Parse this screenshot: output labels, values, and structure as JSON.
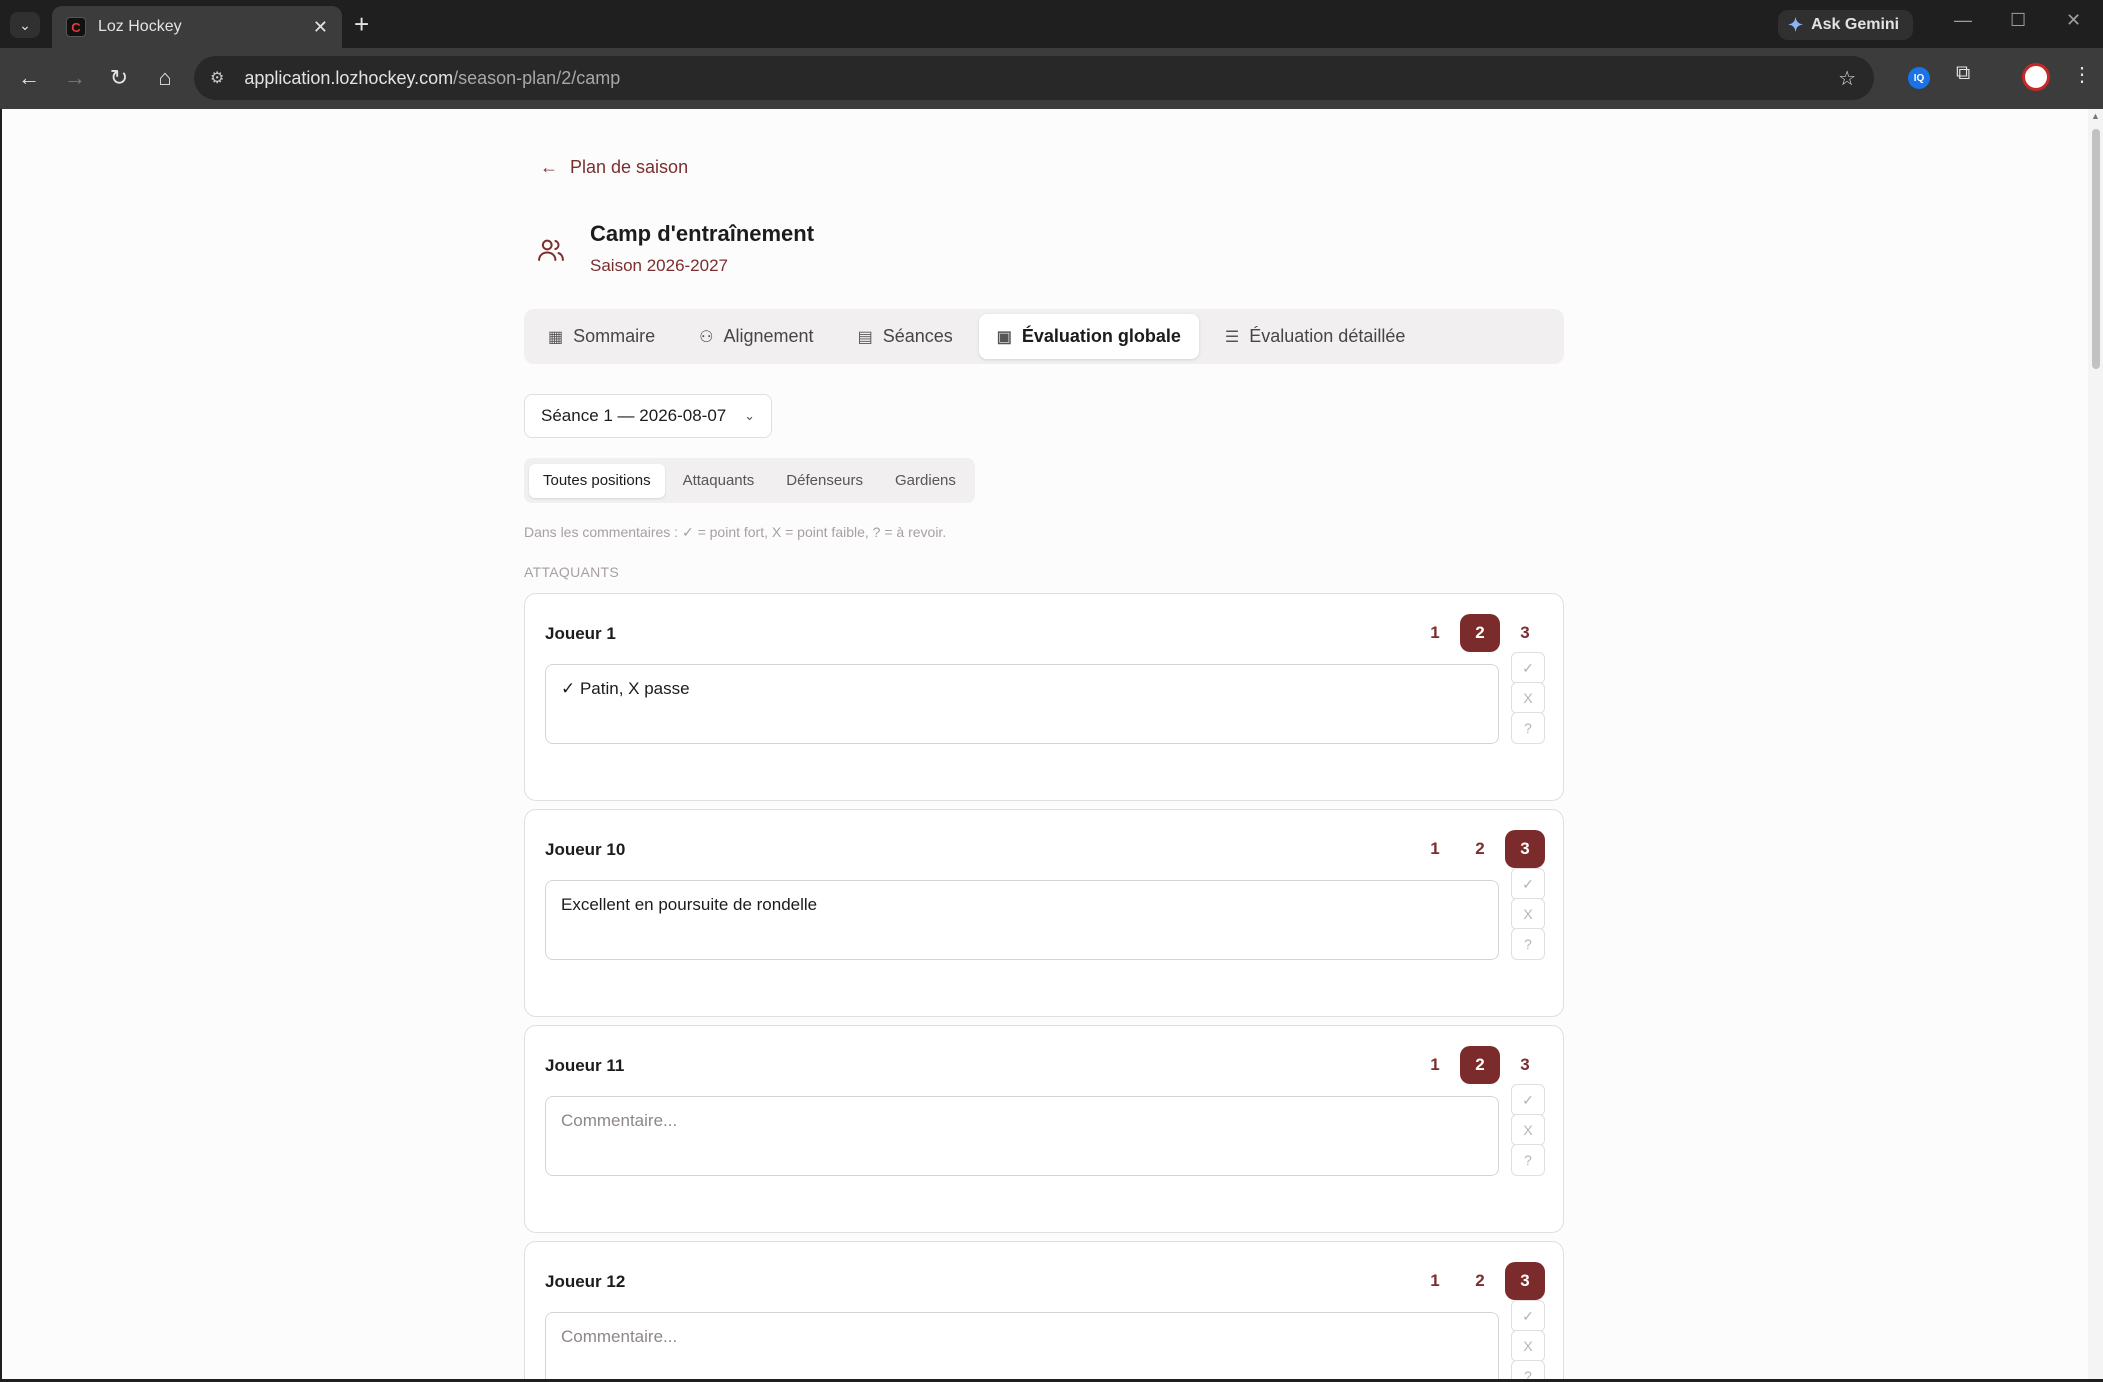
{
  "browser": {
    "tab_title": "Loz Hockey",
    "favicon_text": "C",
    "gemini_label": "Ask Gemini",
    "url_host": "application.lozhockey.com",
    "url_path": "/season-plan/2/camp",
    "ext_badge": "IQ"
  },
  "page": {
    "back_label": "Plan de saison",
    "title": "Camp d'entraînement",
    "subtitle": "Saison 2026-2027",
    "tabs": [
      {
        "label": "Sommaire",
        "icon": "grid-icon"
      },
      {
        "label": "Alignement",
        "icon": "users-icon"
      },
      {
        "label": "Séances",
        "icon": "calendar-icon"
      },
      {
        "label": "Évaluation globale",
        "icon": "clipboard-check-icon"
      },
      {
        "label": "Évaluation détaillée",
        "icon": "list-check-icon"
      }
    ],
    "session_select": "Séance 1 — 2026-08-07",
    "position_tabs": [
      "Toutes positions",
      "Attaquants",
      "Défenseurs",
      "Gardiens"
    ],
    "hint": "Dans les commentaires : ✓ = point fort, X = point faible, ? = à revoir.",
    "section_label": "ATTAQUANTS",
    "rating_labels": [
      "1",
      "2",
      "3"
    ],
    "quick_buttons": [
      "✓",
      "X",
      "?"
    ],
    "players": [
      {
        "name": "Joueur 1",
        "rating": 2,
        "comment": "✓ Patin,  X passe",
        "placeholder": "Commentaire..."
      },
      {
        "name": "Joueur 10",
        "rating": 3,
        "comment": "Excellent en poursuite de rondelle",
        "placeholder": "Commentaire..."
      },
      {
        "name": "Joueur 11",
        "rating": 2,
        "comment": "",
        "placeholder": "Commentaire..."
      },
      {
        "name": "Joueur 12",
        "rating": 3,
        "comment": "",
        "placeholder": "Commentaire..."
      }
    ]
  },
  "colors": {
    "accent": "#7b2b2b",
    "accent_text": "#7a2e2e"
  }
}
